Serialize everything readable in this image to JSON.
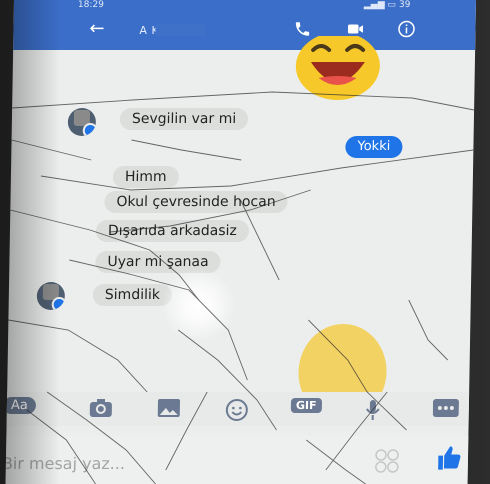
{
  "status_bar": {
    "time": "18:29",
    "right": "39"
  },
  "header": {
    "title": "A K",
    "back_icon": "arrow-left-icon"
  },
  "messages": [
    {
      "text": "Sevgilin var mi",
      "side": "in"
    },
    {
      "text": "Yokki",
      "side": "out"
    },
    {
      "text": "Himm",
      "side": "in"
    },
    {
      "text": "Okul çevresinde hocan",
      "side": "in"
    },
    {
      "text": "Dışarıda arkadasiz",
      "side": "in"
    },
    {
      "text": "Uyar mi şanaa",
      "side": "in"
    },
    {
      "text": "Simdilik",
      "side": "in"
    }
  ],
  "toolbar": {
    "aa_label": "Aa",
    "gif_label": "GIF"
  },
  "composer": {
    "placeholder": "Bir mesaj yaz..."
  },
  "colors": {
    "brand": "#3b6ec8",
    "bubble_out": "#1f74e8",
    "bubble_in": "#dcdedc"
  }
}
